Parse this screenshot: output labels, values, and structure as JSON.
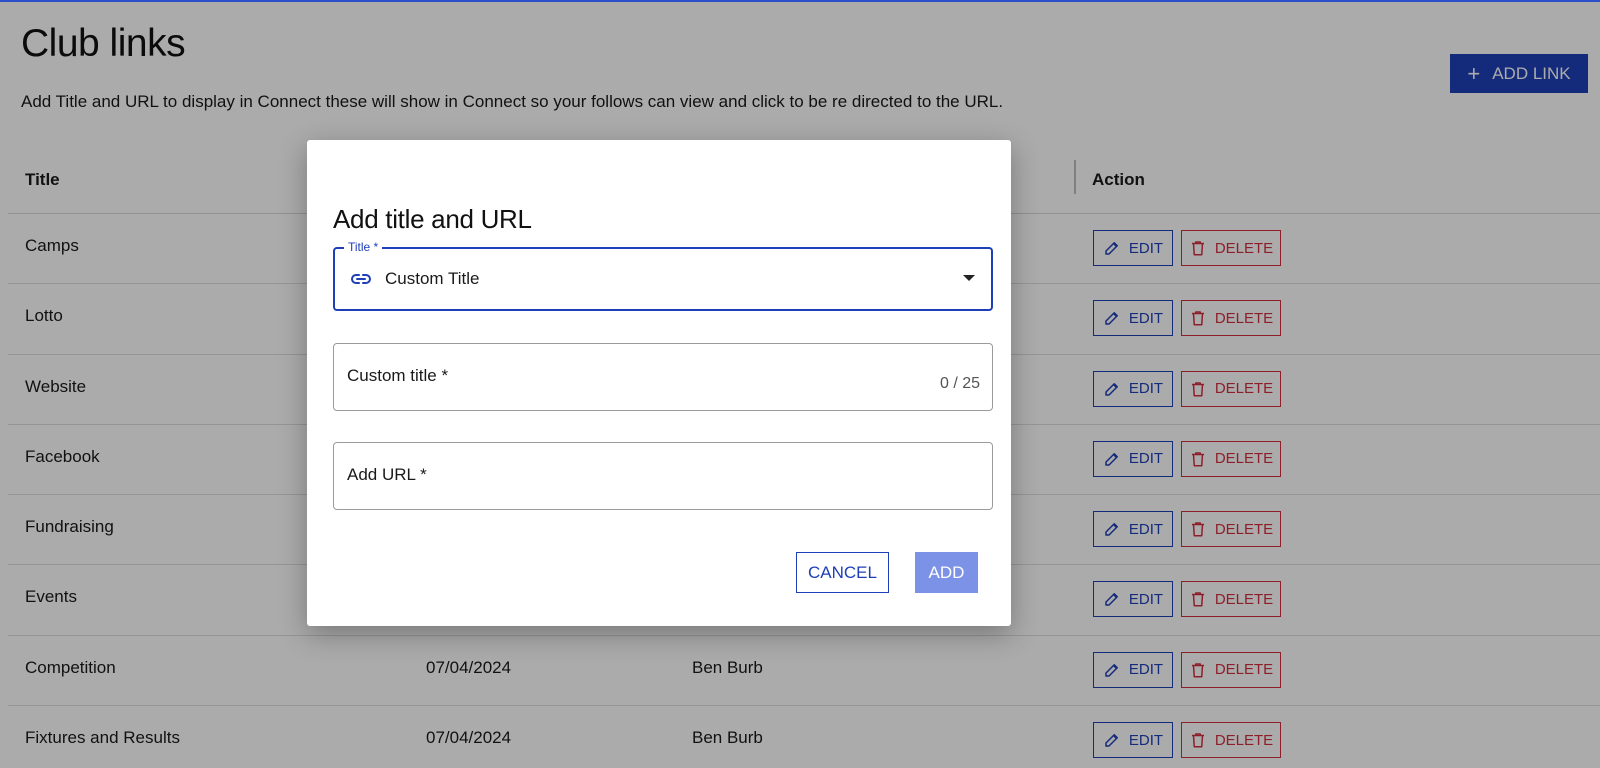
{
  "page": {
    "title": "Club links",
    "description": "Add Title and URL to display in Connect these will show in Connect so your follows can view and click to be re directed to the URL.",
    "add_link_label": "ADD LINK"
  },
  "table": {
    "headers": {
      "title": "Title",
      "action": "Action"
    },
    "edit_label": "EDIT",
    "delete_label": "DELETE",
    "rows": [
      {
        "title": "Camps",
        "date": "",
        "user": ""
      },
      {
        "title": "Lotto",
        "date": "",
        "user": ""
      },
      {
        "title": "Website",
        "date": "",
        "user": ""
      },
      {
        "title": "Facebook",
        "date": "",
        "user": ""
      },
      {
        "title": "Fundraising",
        "date": "",
        "user": ""
      },
      {
        "title": "Events",
        "date": "",
        "user": ""
      },
      {
        "title": "Competition",
        "date": "07/04/2024",
        "user": "Ben Burb"
      },
      {
        "title": "Fixtures and Results",
        "date": "07/04/2024",
        "user": "Ben Burb"
      }
    ]
  },
  "modal": {
    "title": "Add title and URL",
    "title_field": {
      "label": "Title *",
      "value": "Custom Title"
    },
    "custom_title_field": {
      "placeholder": "Custom title *",
      "counter": "0 / 25"
    },
    "url_field": {
      "placeholder": "Add URL *"
    },
    "cancel_label": "CANCEL",
    "add_label": "ADD"
  },
  "colors": {
    "primary": "#1f3fb8",
    "danger": "#d32f3f",
    "add_disabled": "#7b92e6"
  },
  "icons": {
    "add_link": "plus-icon",
    "edit": "pencil-icon",
    "delete": "trash-icon",
    "title_select": "link-icon",
    "dropdown": "caret-down-icon"
  }
}
